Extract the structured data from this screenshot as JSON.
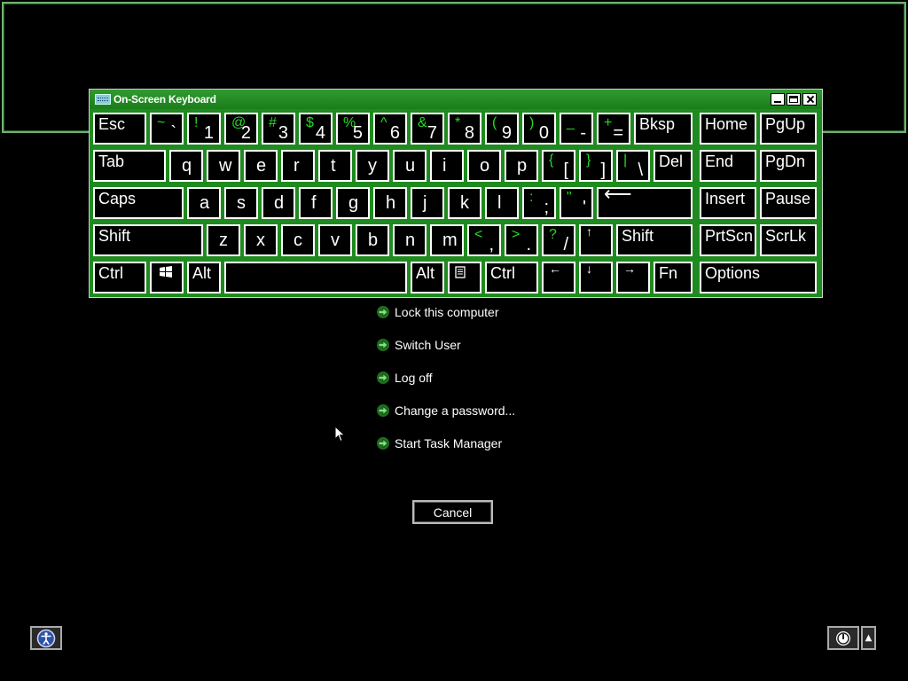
{
  "osk": {
    "title": "On-Screen Keyboard",
    "rows": [
      [
        {
          "id": "esc",
          "label": "Esc"
        },
        {
          "id": "tilde",
          "shift": "~",
          "low": "`"
        },
        {
          "id": "1",
          "shift": "!",
          "low": "1"
        },
        {
          "id": "2",
          "shift": "@",
          "low": "2"
        },
        {
          "id": "3",
          "shift": "#",
          "low": "3"
        },
        {
          "id": "4",
          "shift": "$",
          "low": "4"
        },
        {
          "id": "5",
          "shift": "%",
          "low": "5"
        },
        {
          "id": "6",
          "shift": "^",
          "low": "6"
        },
        {
          "id": "7",
          "shift": "&",
          "low": "7"
        },
        {
          "id": "8",
          "shift": "*",
          "low": "8"
        },
        {
          "id": "9",
          "shift": "(",
          "low": "9"
        },
        {
          "id": "0",
          "shift": ")",
          "low": "0"
        },
        {
          "id": "minus",
          "shift": "_",
          "low": "-"
        },
        {
          "id": "equals",
          "shift": "+",
          "low": "="
        },
        {
          "id": "bksp",
          "label": "Bksp"
        },
        {
          "id": "home",
          "label": "Home"
        },
        {
          "id": "pgup",
          "label": "PgUp"
        }
      ],
      [
        {
          "id": "tab",
          "label": "Tab"
        },
        {
          "id": "q",
          "single": "q"
        },
        {
          "id": "w",
          "single": "w"
        },
        {
          "id": "e",
          "single": "e"
        },
        {
          "id": "r",
          "single": "r"
        },
        {
          "id": "t",
          "single": "t"
        },
        {
          "id": "y",
          "single": "y"
        },
        {
          "id": "u",
          "single": "u"
        },
        {
          "id": "i",
          "single": "i"
        },
        {
          "id": "o",
          "single": "o"
        },
        {
          "id": "p",
          "single": "p"
        },
        {
          "id": "lbracket",
          "shift": "{",
          "low": "["
        },
        {
          "id": "rbracket",
          "shift": "}",
          "low": "]"
        },
        {
          "id": "backslash",
          "shift": "|",
          "low": "\\"
        },
        {
          "id": "del",
          "label": "Del"
        },
        {
          "id": "end",
          "label": "End"
        },
        {
          "id": "pgdn",
          "label": "PgDn"
        }
      ],
      [
        {
          "id": "caps",
          "label": "Caps"
        },
        {
          "id": "a",
          "single": "a"
        },
        {
          "id": "s",
          "single": "s"
        },
        {
          "id": "d",
          "single": "d"
        },
        {
          "id": "f",
          "single": "f"
        },
        {
          "id": "g",
          "single": "g"
        },
        {
          "id": "h",
          "single": "h"
        },
        {
          "id": "j",
          "single": "j"
        },
        {
          "id": "k",
          "single": "k"
        },
        {
          "id": "l",
          "single": "l"
        },
        {
          "id": "semicolon",
          "shift": ":",
          "low": ";"
        },
        {
          "id": "quote",
          "shift": "\"",
          "low": "'"
        },
        {
          "id": "enter",
          "label": "⟵"
        },
        {
          "id": "insert",
          "label": "Insert"
        },
        {
          "id": "pause",
          "label": "Pause"
        }
      ],
      [
        {
          "id": "lshift",
          "label": "Shift"
        },
        {
          "id": "z",
          "single": "z"
        },
        {
          "id": "x",
          "single": "x"
        },
        {
          "id": "c",
          "single": "c"
        },
        {
          "id": "v",
          "single": "v"
        },
        {
          "id": "b",
          "single": "b"
        },
        {
          "id": "n",
          "single": "n"
        },
        {
          "id": "m",
          "single": "m"
        },
        {
          "id": "comma",
          "shift": "<",
          "low": ","
        },
        {
          "id": "period",
          "shift": ">",
          "low": "."
        },
        {
          "id": "slash",
          "shift": "?",
          "low": "/"
        },
        {
          "id": "up",
          "label": "↑"
        },
        {
          "id": "rshift",
          "label": "Shift"
        },
        {
          "id": "prtscn",
          "label": "PrtScn"
        },
        {
          "id": "scrlk",
          "label": "ScrLk"
        }
      ],
      [
        {
          "id": "lctrl",
          "label": "Ctrl"
        },
        {
          "id": "win",
          "label": ""
        },
        {
          "id": "lalt",
          "label": "Alt"
        },
        {
          "id": "space",
          "label": ""
        },
        {
          "id": "ralt",
          "label": "Alt"
        },
        {
          "id": "menu",
          "label": ""
        },
        {
          "id": "rctrl",
          "label": "Ctrl"
        },
        {
          "id": "left",
          "label": "←"
        },
        {
          "id": "down",
          "label": "↓"
        },
        {
          "id": "right",
          "label": "→"
        },
        {
          "id": "fn",
          "label": "Fn"
        },
        {
          "id": "options",
          "label": "Options"
        }
      ]
    ]
  },
  "menu": {
    "items": [
      {
        "id": "lock",
        "label": "Lock this computer"
      },
      {
        "id": "switch-user",
        "label": "Switch User"
      },
      {
        "id": "log-off",
        "label": "Log off"
      },
      {
        "id": "change-password",
        "label": "Change a password..."
      },
      {
        "id": "task-manager",
        "label": "Start Task Manager"
      }
    ]
  },
  "cancel": {
    "label": "Cancel"
  },
  "icons": {
    "ease_of_access": "ease-of-access-icon",
    "power": "power-icon",
    "power_menu": "triangle-up-icon"
  },
  "colors": {
    "accent_green": "#1f8a1f",
    "key_shift_text": "#22dd22",
    "arrow_green": "#2fa82f"
  }
}
